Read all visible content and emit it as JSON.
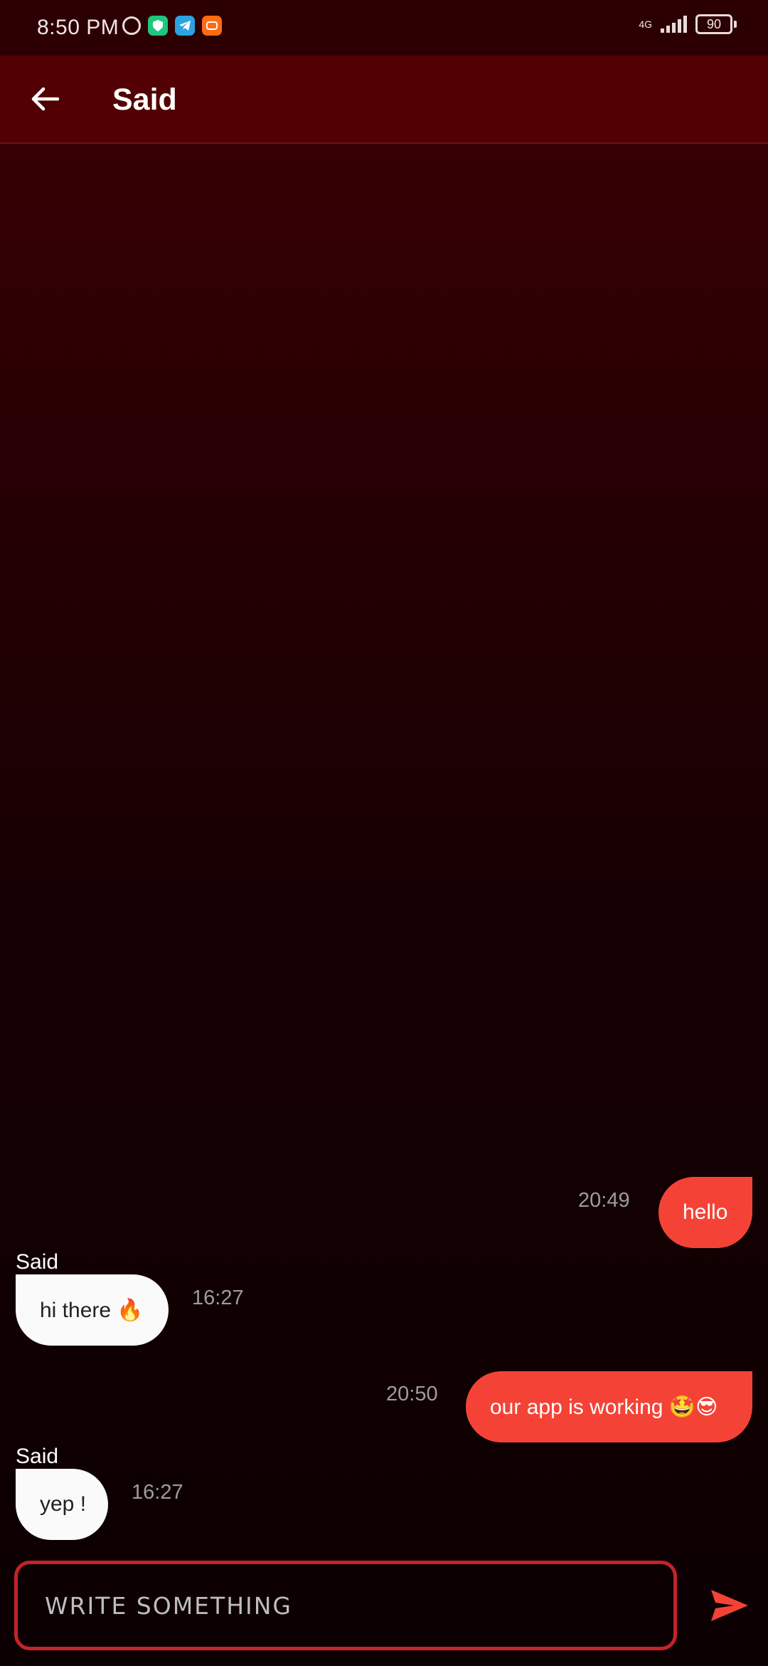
{
  "status_bar": {
    "time": "8:50 PM",
    "network": "4G",
    "battery": "90",
    "icons": [
      "alarm-icon",
      "shield-app-icon",
      "telegram-icon",
      "mi-app-icon"
    ]
  },
  "header": {
    "title": "Said",
    "back_icon": "arrow-left-icon"
  },
  "messages": [
    {
      "direction": "sent",
      "text": "hello",
      "time": "20:49"
    },
    {
      "direction": "received",
      "sender": "Said",
      "text": "hi there 🔥",
      "time": "16:27"
    },
    {
      "direction": "sent",
      "text": "our app is working 🤩😎",
      "time": "20:50"
    },
    {
      "direction": "received",
      "sender": "Said",
      "text": "yep !",
      "time": "16:27"
    }
  ],
  "composer": {
    "placeholder": "WRITE SOMETHING",
    "value": "",
    "send_icon": "send-icon"
  },
  "colors": {
    "appbar": "#520003",
    "sent_bubble": "#f44336",
    "received_bubble": "#fafafa",
    "input_border": "#c4232a"
  }
}
